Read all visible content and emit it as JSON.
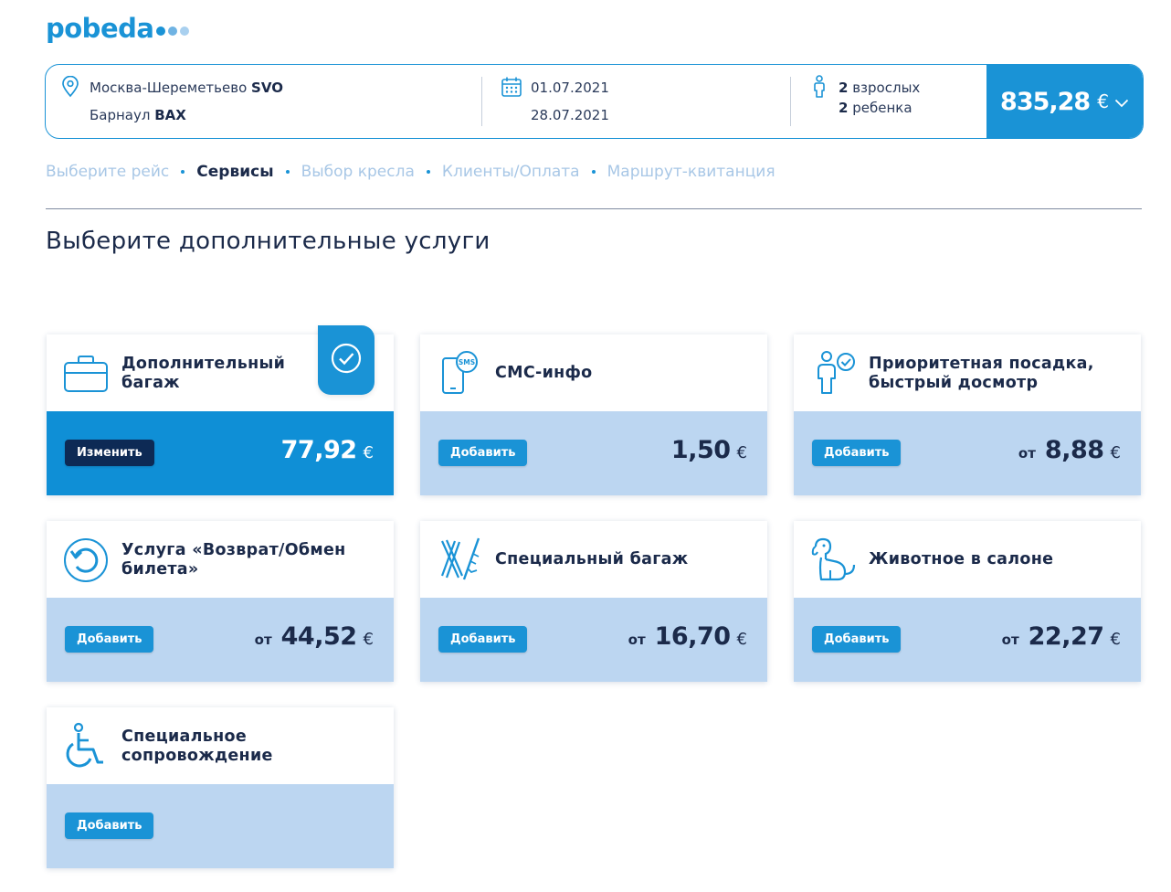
{
  "brand": {
    "logo_text": "pobeda",
    "primary_color": "#1a93d6",
    "dark_color": "#0d2a55",
    "light_bg": "#bcd6f1"
  },
  "search": {
    "origin_city": "Москва-Шереметьево",
    "origin_code": "SVO",
    "destination_city": "Барнаул",
    "destination_code": "BAX",
    "date_out": "01.07.2021",
    "date_back": "28.07.2021",
    "adults_count": "2",
    "adults_label": "взрослых",
    "children_count": "2",
    "children_label": "ребенка",
    "total_price": "835,28",
    "currency": "€"
  },
  "steps": [
    {
      "label": "Выберите рейс",
      "active": false
    },
    {
      "label": "Сервисы",
      "active": true
    },
    {
      "label": "Выбор кресла",
      "active": false
    },
    {
      "label": "Клиенты/Оплата",
      "active": false
    },
    {
      "label": "Маршрут-квитанция",
      "active": false
    }
  ],
  "page_title": "Выберите дополнительные услуги",
  "services": [
    {
      "id": "extra-baggage",
      "icon": "suitcase-icon",
      "title_line1": "Дополнительный",
      "title_line2": "багаж",
      "button": "Изменить",
      "from": "",
      "price": "77,92",
      "currency": "€",
      "selected": true
    },
    {
      "id": "sms-info",
      "icon": "sms-phone-icon",
      "title_line1": "СМС-инфо",
      "title_line2": "",
      "button": "Добавить",
      "from": "",
      "price": "1,50",
      "currency": "€",
      "selected": false
    },
    {
      "id": "priority-boarding",
      "icon": "person-check-icon",
      "title_line1": "Приоритетная посадка,",
      "title_line2": "быстрый досмотр",
      "button": "Добавить",
      "from": "от",
      "price": "8,88",
      "currency": "€",
      "selected": false
    },
    {
      "id": "refund-exchange",
      "icon": "refund-arrow-icon",
      "title_line1": "Услуга «Возврат/Обмен",
      "title_line2": "билета»",
      "button": "Добавить",
      "from": "от",
      "price": "44,52",
      "currency": "€",
      "selected": false
    },
    {
      "id": "special-baggage",
      "icon": "skis-icon",
      "title_line1": "Специальный багаж",
      "title_line2": "",
      "button": "Добавить",
      "from": "от",
      "price": "16,70",
      "currency": "€",
      "selected": false
    },
    {
      "id": "pet-in-cabin",
      "icon": "dog-icon",
      "title_line1": "Животное в салоне",
      "title_line2": "",
      "button": "Добавить",
      "from": "от",
      "price": "22,27",
      "currency": "€",
      "selected": false
    },
    {
      "id": "special-assistance",
      "icon": "wheelchair-icon",
      "title_line1": "Специальное",
      "title_line2": "сопровождение",
      "button": "Добавить",
      "from": "",
      "price": "",
      "currency": "",
      "selected": false
    }
  ]
}
